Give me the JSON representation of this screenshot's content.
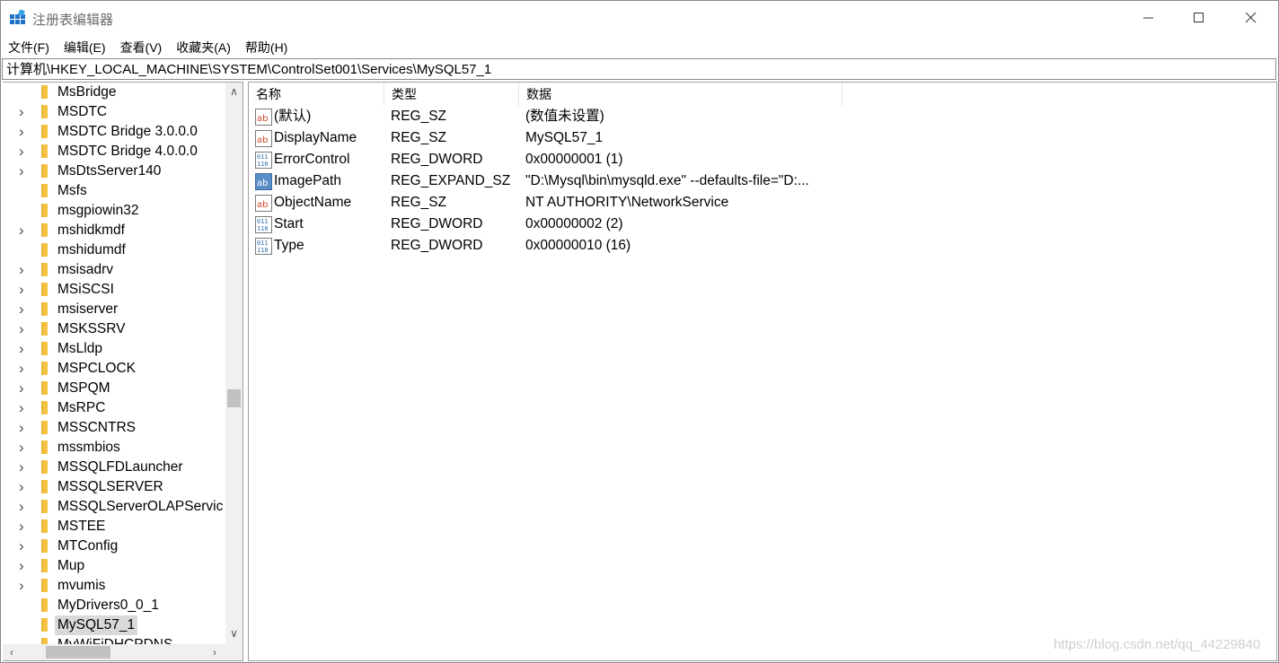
{
  "window": {
    "title": "注册表编辑器"
  },
  "menu": [
    "文件(F)",
    "编辑(E)",
    "查看(V)",
    "收藏夹(A)",
    "帮助(H)"
  ],
  "address": "计算机\\HKEY_LOCAL_MACHINE\\SYSTEM\\ControlSet001\\Services\\MySQL57_1",
  "tree": {
    "items": [
      {
        "label": "MsBridge",
        "expandable": false
      },
      {
        "label": "MSDTC",
        "expandable": true
      },
      {
        "label": "MSDTC Bridge 3.0.0.0",
        "expandable": true
      },
      {
        "label": "MSDTC Bridge 4.0.0.0",
        "expandable": true
      },
      {
        "label": "MsDtsServer140",
        "expandable": true
      },
      {
        "label": "Msfs",
        "expandable": false
      },
      {
        "label": "msgpiowin32",
        "expandable": false
      },
      {
        "label": "mshidkmdf",
        "expandable": true
      },
      {
        "label": "mshidumdf",
        "expandable": false
      },
      {
        "label": "msisadrv",
        "expandable": true
      },
      {
        "label": "MSiSCSI",
        "expandable": true
      },
      {
        "label": "msiserver",
        "expandable": true
      },
      {
        "label": "MSKSSRV",
        "expandable": true
      },
      {
        "label": "MsLldp",
        "expandable": true
      },
      {
        "label": "MSPCLOCK",
        "expandable": true
      },
      {
        "label": "MSPQM",
        "expandable": true
      },
      {
        "label": "MsRPC",
        "expandable": true
      },
      {
        "label": "MSSCNTRS",
        "expandable": true
      },
      {
        "label": "mssmbios",
        "expandable": true
      },
      {
        "label": "MSSQLFDLauncher",
        "expandable": true
      },
      {
        "label": "MSSQLSERVER",
        "expandable": true
      },
      {
        "label": "MSSQLServerOLAPServic",
        "expandable": true
      },
      {
        "label": "MSTEE",
        "expandable": true
      },
      {
        "label": "MTConfig",
        "expandable": true
      },
      {
        "label": "Mup",
        "expandable": true
      },
      {
        "label": "mvumis",
        "expandable": true
      },
      {
        "label": "MyDrivers0_0_1",
        "expandable": false
      },
      {
        "label": "MySQL57_1",
        "expandable": false,
        "selected": true
      },
      {
        "label": "MyWiFiDHCPDNS",
        "expandable": false
      }
    ]
  },
  "values": {
    "headers": {
      "name": "名称",
      "type": "类型",
      "data": "数据"
    },
    "rows": [
      {
        "icon": "string-value-icon",
        "name": "(默认)",
        "type": "REG_SZ",
        "data": "(数值未设置)"
      },
      {
        "icon": "string-value-icon",
        "name": "DisplayName",
        "type": "REG_SZ",
        "data": "MySQL57_1"
      },
      {
        "icon": "binary-value-icon",
        "name": "ErrorControl",
        "type": "REG_DWORD",
        "data": "0x00000001 (1)"
      },
      {
        "icon": "expand-string-value-icon",
        "name": "ImagePath",
        "type": "REG_EXPAND_SZ",
        "data": "\"D:\\Mysql\\bin\\mysqld.exe\" --defaults-file=\"D:..."
      },
      {
        "icon": "string-value-icon",
        "name": "ObjectName",
        "type": "REG_SZ",
        "data": "NT AUTHORITY\\NetworkService"
      },
      {
        "icon": "binary-value-icon",
        "name": "Start",
        "type": "REG_DWORD",
        "data": "0x00000002 (2)"
      },
      {
        "icon": "binary-value-icon",
        "name": "Type",
        "type": "REG_DWORD",
        "data": "0x00000010 (16)"
      }
    ]
  },
  "watermark": "https://blog.csdn.net/qq_44229840",
  "colors": {
    "folder": "#f5c342",
    "selected_bg": "#d9d9d9",
    "ab_red": "#d24726",
    "bin_blue": "#2f6fb3"
  }
}
